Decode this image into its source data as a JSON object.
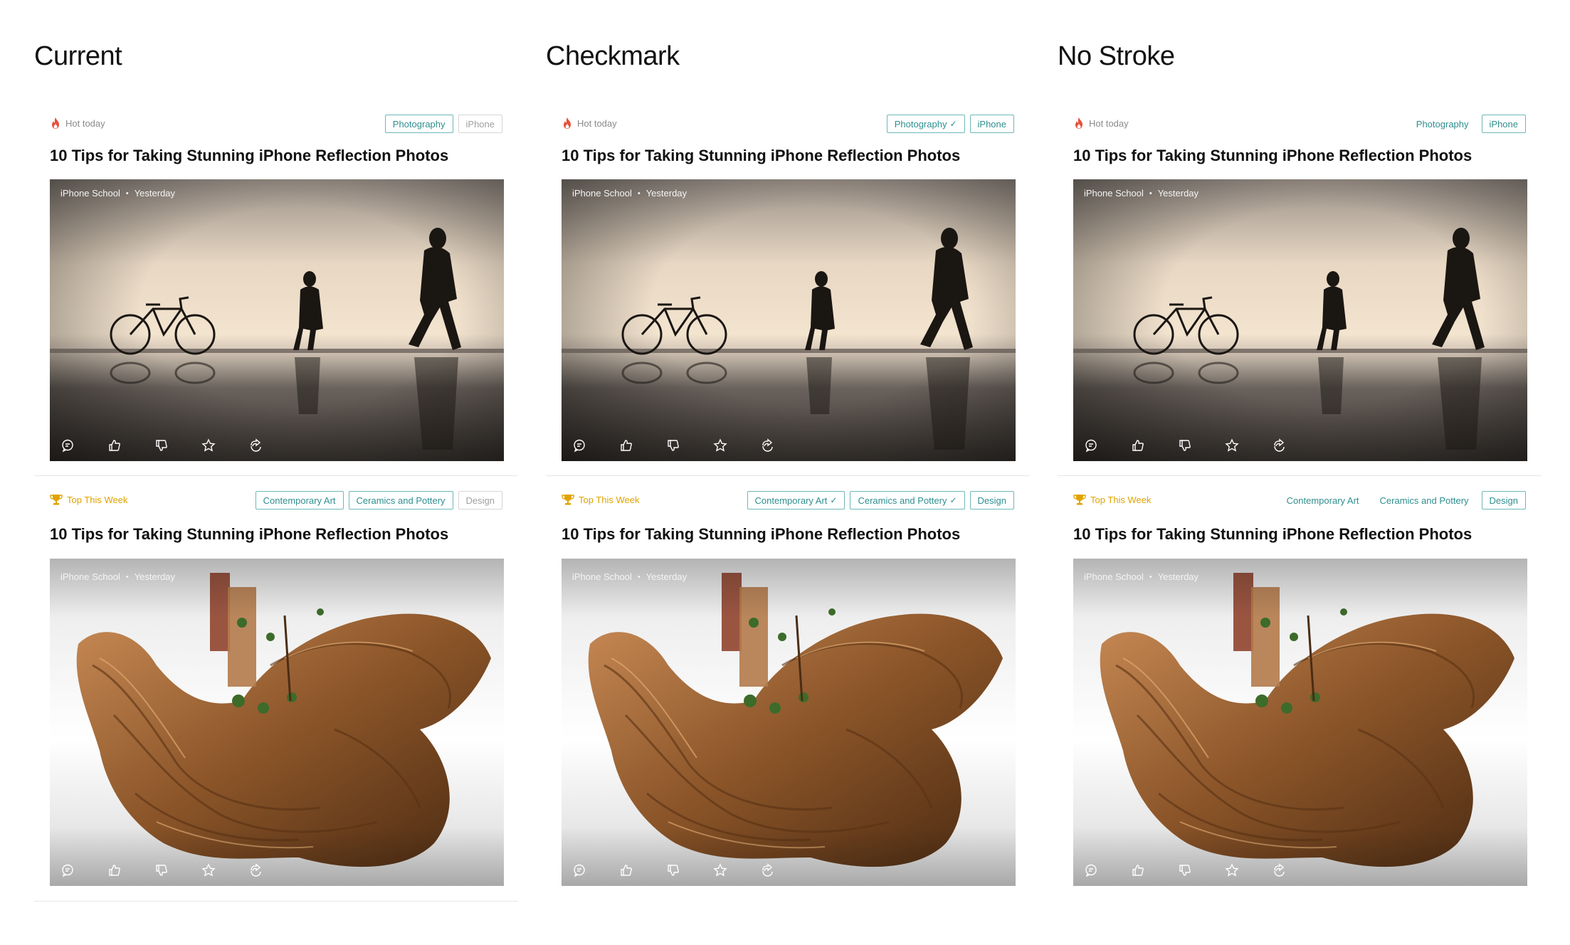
{
  "columns": [
    {
      "title": "Current",
      "cards": [
        {
          "badge": "Hot today",
          "tags": [
            {
              "label": "Photography",
              "checked": false
            },
            {
              "label": "iPhone",
              "checked": false
            }
          ],
          "headline": "10 Tips for Taking Stunning iPhone Reflection Photos",
          "byline": {
            "source": "iPhone School",
            "time": "Yesterday"
          }
        },
        {
          "badge": "Top This Week",
          "tags": [
            {
              "label": "Contemporary Art",
              "checked": false
            },
            {
              "label": "Ceramics and Pottery",
              "checked": false
            },
            {
              "label": "Design",
              "checked": false
            }
          ],
          "headline": "10 Tips for Taking Stunning iPhone Reflection Photos",
          "byline": {
            "source": "iPhone School",
            "time": "Yesterday"
          }
        }
      ]
    },
    {
      "title": "Checkmark",
      "cards": [
        {
          "badge": "Hot today",
          "tags": [
            {
              "label": "Photography",
              "checked": true
            },
            {
              "label": "iPhone",
              "checked": false
            }
          ],
          "headline": "10 Tips for Taking Stunning iPhone Reflection Photos",
          "byline": {
            "source": "iPhone School",
            "time": "Yesterday"
          }
        },
        {
          "badge": "Top This Week",
          "tags": [
            {
              "label": "Contemporary Art",
              "checked": true
            },
            {
              "label": "Ceramics and Pottery",
              "checked": true
            },
            {
              "label": "Design",
              "checked": false
            }
          ],
          "headline": "10 Tips for Taking Stunning iPhone Reflection Photos",
          "byline": {
            "source": "iPhone School",
            "time": "Yesterday"
          }
        }
      ]
    },
    {
      "title": "No Stroke",
      "cards": [
        {
          "badge": "Hot today",
          "tags": [
            {
              "label": "Photography",
              "checked": true
            },
            {
              "label": "iPhone",
              "checked": false
            }
          ],
          "headline": "10 Tips for Taking Stunning iPhone Reflection Photos",
          "byline": {
            "source": "iPhone School",
            "time": "Yesterday"
          }
        },
        {
          "badge": "Top This Week",
          "tags": [
            {
              "label": "Contemporary Art",
              "checked": true
            },
            {
              "label": "Ceramics and Pottery",
              "checked": true
            },
            {
              "label": "Design",
              "checked": false
            }
          ],
          "headline": "10 Tips for Taking Stunning iPhone Reflection Photos",
          "byline": {
            "source": "iPhone School",
            "time": "Yesterday"
          }
        }
      ]
    }
  ],
  "icons": {
    "hot": "flame-icon",
    "top": "trophy-icon",
    "actions": [
      "comment-icon",
      "thumbs-up-icon",
      "thumbs-down-icon",
      "star-icon",
      "share-icon"
    ]
  },
  "colors": {
    "tag_selected": "#2f8f8f",
    "tag_unselected": "#a0a0a0",
    "hot": "#e8503a",
    "top": "#e0a300"
  }
}
